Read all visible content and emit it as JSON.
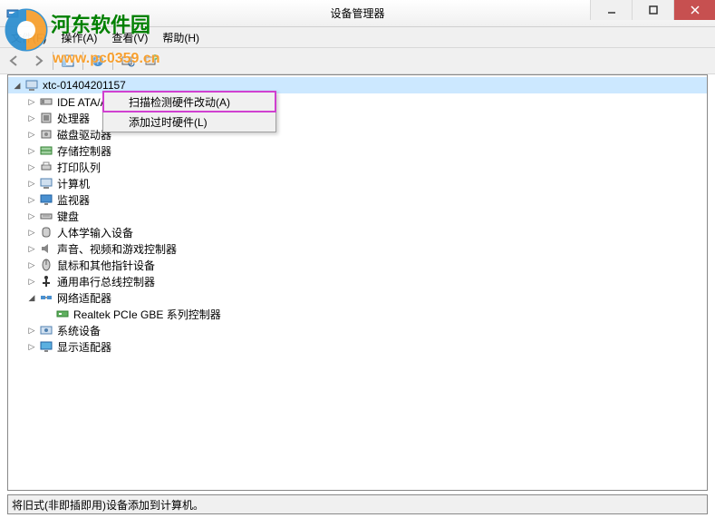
{
  "window": {
    "title": "设备管理器"
  },
  "menubar": {
    "file": "文件(F)",
    "action": "操作(A)",
    "view": "查看(V)",
    "help": "帮助(H)"
  },
  "tree": {
    "root": "xtc-01404201157",
    "items": [
      {
        "label": "IDE ATA/ATAPI 控制器",
        "icon": "ide"
      },
      {
        "label": "处理器",
        "icon": "cpu"
      },
      {
        "label": "磁盘驱动器",
        "icon": "disk"
      },
      {
        "label": "存储控制器",
        "icon": "storage"
      },
      {
        "label": "打印队列",
        "icon": "printer"
      },
      {
        "label": "计算机",
        "icon": "computer"
      },
      {
        "label": "监视器",
        "icon": "monitor"
      },
      {
        "label": "键盘",
        "icon": "keyboard"
      },
      {
        "label": "人体学输入设备",
        "icon": "hid"
      },
      {
        "label": "声音、视频和游戏控制器",
        "icon": "sound"
      },
      {
        "label": "鼠标和其他指针设备",
        "icon": "mouse"
      },
      {
        "label": "通用串行总线控制器",
        "icon": "usb"
      }
    ],
    "network": {
      "label": "网络适配器",
      "child": "Realtek PCIe GBE 系列控制器"
    },
    "after": [
      {
        "label": "系统设备",
        "icon": "system"
      },
      {
        "label": "显示适配器",
        "icon": "display"
      }
    ]
  },
  "context_menu": {
    "scan": "扫描检测硬件改动(A)",
    "add_legacy": "添加过时硬件(L)"
  },
  "statusbar": {
    "text": "将旧式(非即插即用)设备添加到计算机。"
  },
  "watermark": {
    "site_cn": "河东软件园",
    "site_url": "www.pc0359.cn"
  }
}
